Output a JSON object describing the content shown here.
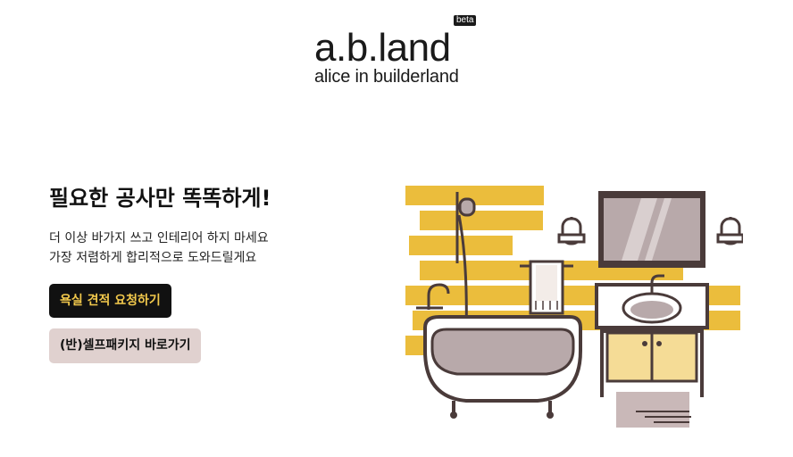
{
  "header": {
    "logo_text": "a.b.land",
    "tagline": "alice in builderland",
    "badge": "beta"
  },
  "hero": {
    "headline": "필요한 공사만 똑똑하게!",
    "description_lines": [
      "더 이상 바가지 쓰고 인테리어 하지 마세요",
      "가장 저렴하게 합리적으로 도와드릴게요"
    ],
    "primary_button": "욕실 견적 요청하기",
    "secondary_button": "(반)셀프패키지 바로가기"
  },
  "colors": {
    "primary_button_bg": "#111111",
    "primary_button_text": "#f2c94c",
    "secondary_button_bg": "#e0d1cf",
    "tile_yellow": "#ebbd3c",
    "line_dark": "#4a3b3a"
  },
  "illustration": {
    "icon": "bathroom-illustration"
  }
}
